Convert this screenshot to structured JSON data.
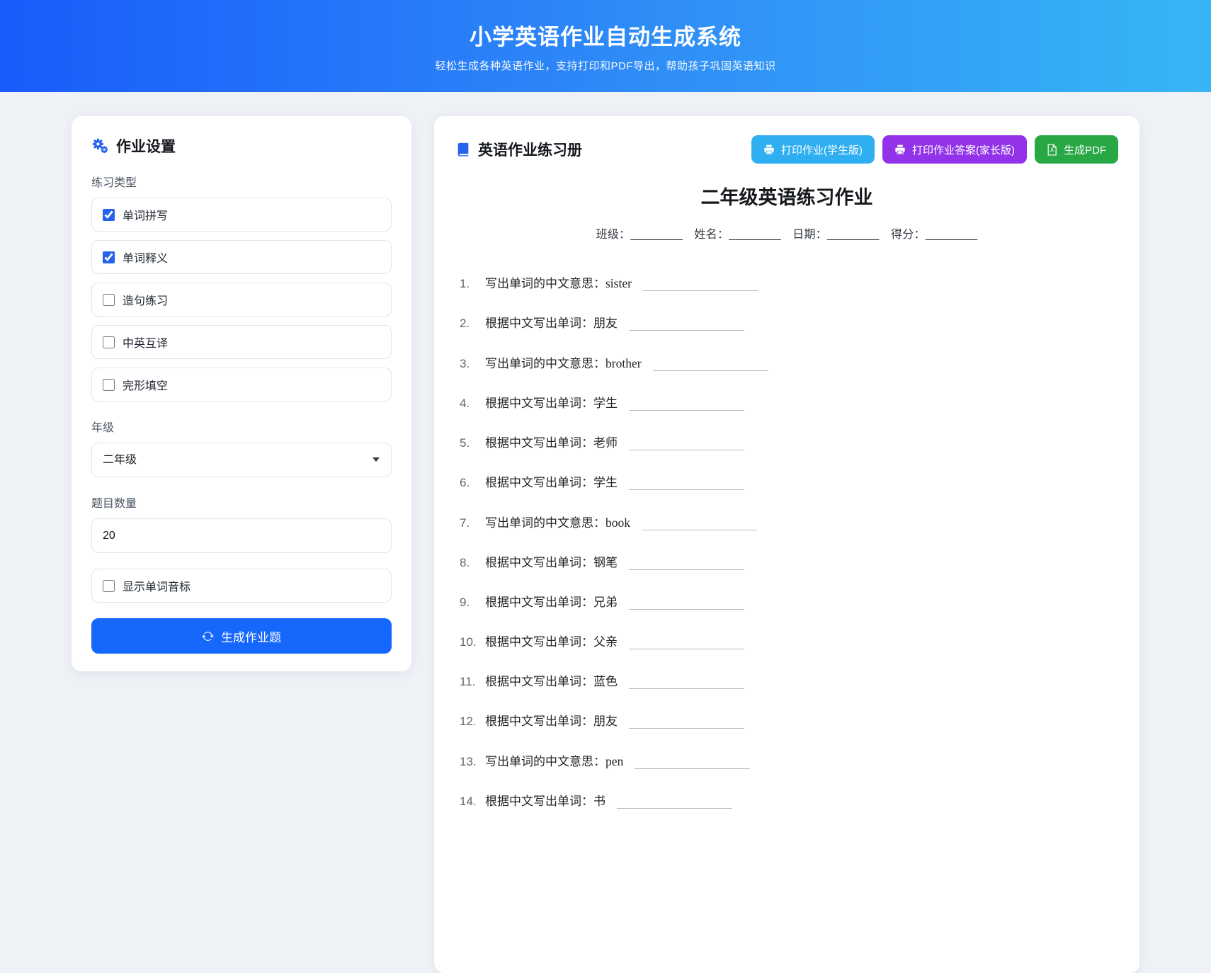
{
  "header": {
    "title": "小学英语作业自动生成系统",
    "subtitle": "轻松生成各种英语作业，支持打印和PDF导出，帮助孩子巩固英语知识",
    "gradient_from": "#1a5bfb",
    "gradient_to": "#36b5f6"
  },
  "settings": {
    "title": "作业设置",
    "exercise_type_label": "练习类型",
    "exercise_types": [
      {
        "label": "单词拼写",
        "checked": true
      },
      {
        "label": "单词释义",
        "checked": true
      },
      {
        "label": "造句练习",
        "checked": false
      },
      {
        "label": "中英互译",
        "checked": false
      },
      {
        "label": "完形填空",
        "checked": false
      }
    ],
    "grade_label": "年级",
    "grade_value": "二年级",
    "count_label": "题目数量",
    "count_value": "20",
    "phonetic_label": "显示单词音标",
    "phonetic_checked": false,
    "generate_label": "生成作业题",
    "accent_color": "#1667fb",
    "icon_color": "#2563eb"
  },
  "workbook": {
    "title": "英语作业练习册",
    "print_student_label": "打印作业(学生版)",
    "print_parent_label": "打印作业答案(家长版)",
    "pdf_label": "生成PDF",
    "print_student_color": "#30aef2",
    "print_parent_color": "#9233e9",
    "pdf_color": "#28a745"
  },
  "sheet": {
    "title": "二年级英语练习作业",
    "meta": "班级：________　姓名：________　日期：________　得分：________",
    "questions": [
      {
        "num": "1.",
        "prompt": "写出单词的中文意思：",
        "word": "sister",
        "word_class": "q-word en"
      },
      {
        "num": "2.",
        "prompt": "根据中文写出单词：",
        "word": "朋友",
        "word_class": "q-word zh"
      },
      {
        "num": "3.",
        "prompt": "写出单词的中文意思：",
        "word": "brother",
        "word_class": "q-word en"
      },
      {
        "num": "4.",
        "prompt": "根据中文写出单词：",
        "word": "学生",
        "word_class": "q-word zh"
      },
      {
        "num": "5.",
        "prompt": "根据中文写出单词：",
        "word": "老师",
        "word_class": "q-word zh"
      },
      {
        "num": "6.",
        "prompt": "根据中文写出单词：",
        "word": "学生",
        "word_class": "q-word zh"
      },
      {
        "num": "7.",
        "prompt": "写出单词的中文意思：",
        "word": "book",
        "word_class": "q-word en"
      },
      {
        "num": "8.",
        "prompt": "根据中文写出单词：",
        "word": "钢笔",
        "word_class": "q-word zh"
      },
      {
        "num": "9.",
        "prompt": "根据中文写出单词：",
        "word": "兄弟",
        "word_class": "q-word zh"
      },
      {
        "num": "10.",
        "prompt": "根据中文写出单词：",
        "word": "父亲",
        "word_class": "q-word zh"
      },
      {
        "num": "11.",
        "prompt": "根据中文写出单词：",
        "word": "蓝色",
        "word_class": "q-word zh"
      },
      {
        "num": "12.",
        "prompt": "根据中文写出单词：",
        "word": "朋友",
        "word_class": "q-word zh"
      },
      {
        "num": "13.",
        "prompt": "写出单词的中文意思：",
        "word": "pen",
        "word_class": "q-word en"
      },
      {
        "num": "14.",
        "prompt": "根据中文写出单词：",
        "word": "书",
        "word_class": "q-word zh"
      }
    ]
  },
  "icons": {
    "settings": "gears-icon",
    "workbook": "book-icon",
    "print": "printer-icon",
    "pdf": "file-pdf-icon",
    "generate": "refresh-icon",
    "grade_select": "chevron-down-icon"
  }
}
